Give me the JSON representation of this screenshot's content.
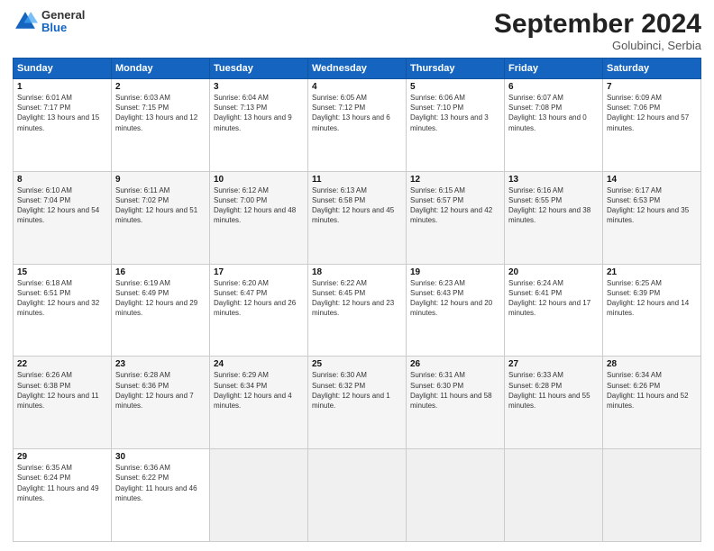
{
  "header": {
    "logo_general": "General",
    "logo_blue": "Blue",
    "month_title": "September 2024",
    "location": "Golubinci, Serbia"
  },
  "days_of_week": [
    "Sunday",
    "Monday",
    "Tuesday",
    "Wednesday",
    "Thursday",
    "Friday",
    "Saturday"
  ],
  "weeks": [
    [
      {
        "day": "1",
        "sunrise": "6:01 AM",
        "sunset": "7:17 PM",
        "daylight": "13 hours and 15 minutes."
      },
      {
        "day": "2",
        "sunrise": "6:03 AM",
        "sunset": "7:15 PM",
        "daylight": "13 hours and 12 minutes."
      },
      {
        "day": "3",
        "sunrise": "6:04 AM",
        "sunset": "7:13 PM",
        "daylight": "13 hours and 9 minutes."
      },
      {
        "day": "4",
        "sunrise": "6:05 AM",
        "sunset": "7:12 PM",
        "daylight": "13 hours and 6 minutes."
      },
      {
        "day": "5",
        "sunrise": "6:06 AM",
        "sunset": "7:10 PM",
        "daylight": "13 hours and 3 minutes."
      },
      {
        "day": "6",
        "sunrise": "6:07 AM",
        "sunset": "7:08 PM",
        "daylight": "13 hours and 0 minutes."
      },
      {
        "day": "7",
        "sunrise": "6:09 AM",
        "sunset": "7:06 PM",
        "daylight": "12 hours and 57 minutes."
      }
    ],
    [
      {
        "day": "8",
        "sunrise": "6:10 AM",
        "sunset": "7:04 PM",
        "daylight": "12 hours and 54 minutes."
      },
      {
        "day": "9",
        "sunrise": "6:11 AM",
        "sunset": "7:02 PM",
        "daylight": "12 hours and 51 minutes."
      },
      {
        "day": "10",
        "sunrise": "6:12 AM",
        "sunset": "7:00 PM",
        "daylight": "12 hours and 48 minutes."
      },
      {
        "day": "11",
        "sunrise": "6:13 AM",
        "sunset": "6:58 PM",
        "daylight": "12 hours and 45 minutes."
      },
      {
        "day": "12",
        "sunrise": "6:15 AM",
        "sunset": "6:57 PM",
        "daylight": "12 hours and 42 minutes."
      },
      {
        "day": "13",
        "sunrise": "6:16 AM",
        "sunset": "6:55 PM",
        "daylight": "12 hours and 38 minutes."
      },
      {
        "day": "14",
        "sunrise": "6:17 AM",
        "sunset": "6:53 PM",
        "daylight": "12 hours and 35 minutes."
      }
    ],
    [
      {
        "day": "15",
        "sunrise": "6:18 AM",
        "sunset": "6:51 PM",
        "daylight": "12 hours and 32 minutes."
      },
      {
        "day": "16",
        "sunrise": "6:19 AM",
        "sunset": "6:49 PM",
        "daylight": "12 hours and 29 minutes."
      },
      {
        "day": "17",
        "sunrise": "6:20 AM",
        "sunset": "6:47 PM",
        "daylight": "12 hours and 26 minutes."
      },
      {
        "day": "18",
        "sunrise": "6:22 AM",
        "sunset": "6:45 PM",
        "daylight": "12 hours and 23 minutes."
      },
      {
        "day": "19",
        "sunrise": "6:23 AM",
        "sunset": "6:43 PM",
        "daylight": "12 hours and 20 minutes."
      },
      {
        "day": "20",
        "sunrise": "6:24 AM",
        "sunset": "6:41 PM",
        "daylight": "12 hours and 17 minutes."
      },
      {
        "day": "21",
        "sunrise": "6:25 AM",
        "sunset": "6:39 PM",
        "daylight": "12 hours and 14 minutes."
      }
    ],
    [
      {
        "day": "22",
        "sunrise": "6:26 AM",
        "sunset": "6:38 PM",
        "daylight": "12 hours and 11 minutes."
      },
      {
        "day": "23",
        "sunrise": "6:28 AM",
        "sunset": "6:36 PM",
        "daylight": "12 hours and 7 minutes."
      },
      {
        "day": "24",
        "sunrise": "6:29 AM",
        "sunset": "6:34 PM",
        "daylight": "12 hours and 4 minutes."
      },
      {
        "day": "25",
        "sunrise": "6:30 AM",
        "sunset": "6:32 PM",
        "daylight": "12 hours and 1 minute."
      },
      {
        "day": "26",
        "sunrise": "6:31 AM",
        "sunset": "6:30 PM",
        "daylight": "11 hours and 58 minutes."
      },
      {
        "day": "27",
        "sunrise": "6:33 AM",
        "sunset": "6:28 PM",
        "daylight": "11 hours and 55 minutes."
      },
      {
        "day": "28",
        "sunrise": "6:34 AM",
        "sunset": "6:26 PM",
        "daylight": "11 hours and 52 minutes."
      }
    ],
    [
      {
        "day": "29",
        "sunrise": "6:35 AM",
        "sunset": "6:24 PM",
        "daylight": "11 hours and 49 minutes."
      },
      {
        "day": "30",
        "sunrise": "6:36 AM",
        "sunset": "6:22 PM",
        "daylight": "11 hours and 46 minutes."
      },
      null,
      null,
      null,
      null,
      null
    ]
  ]
}
